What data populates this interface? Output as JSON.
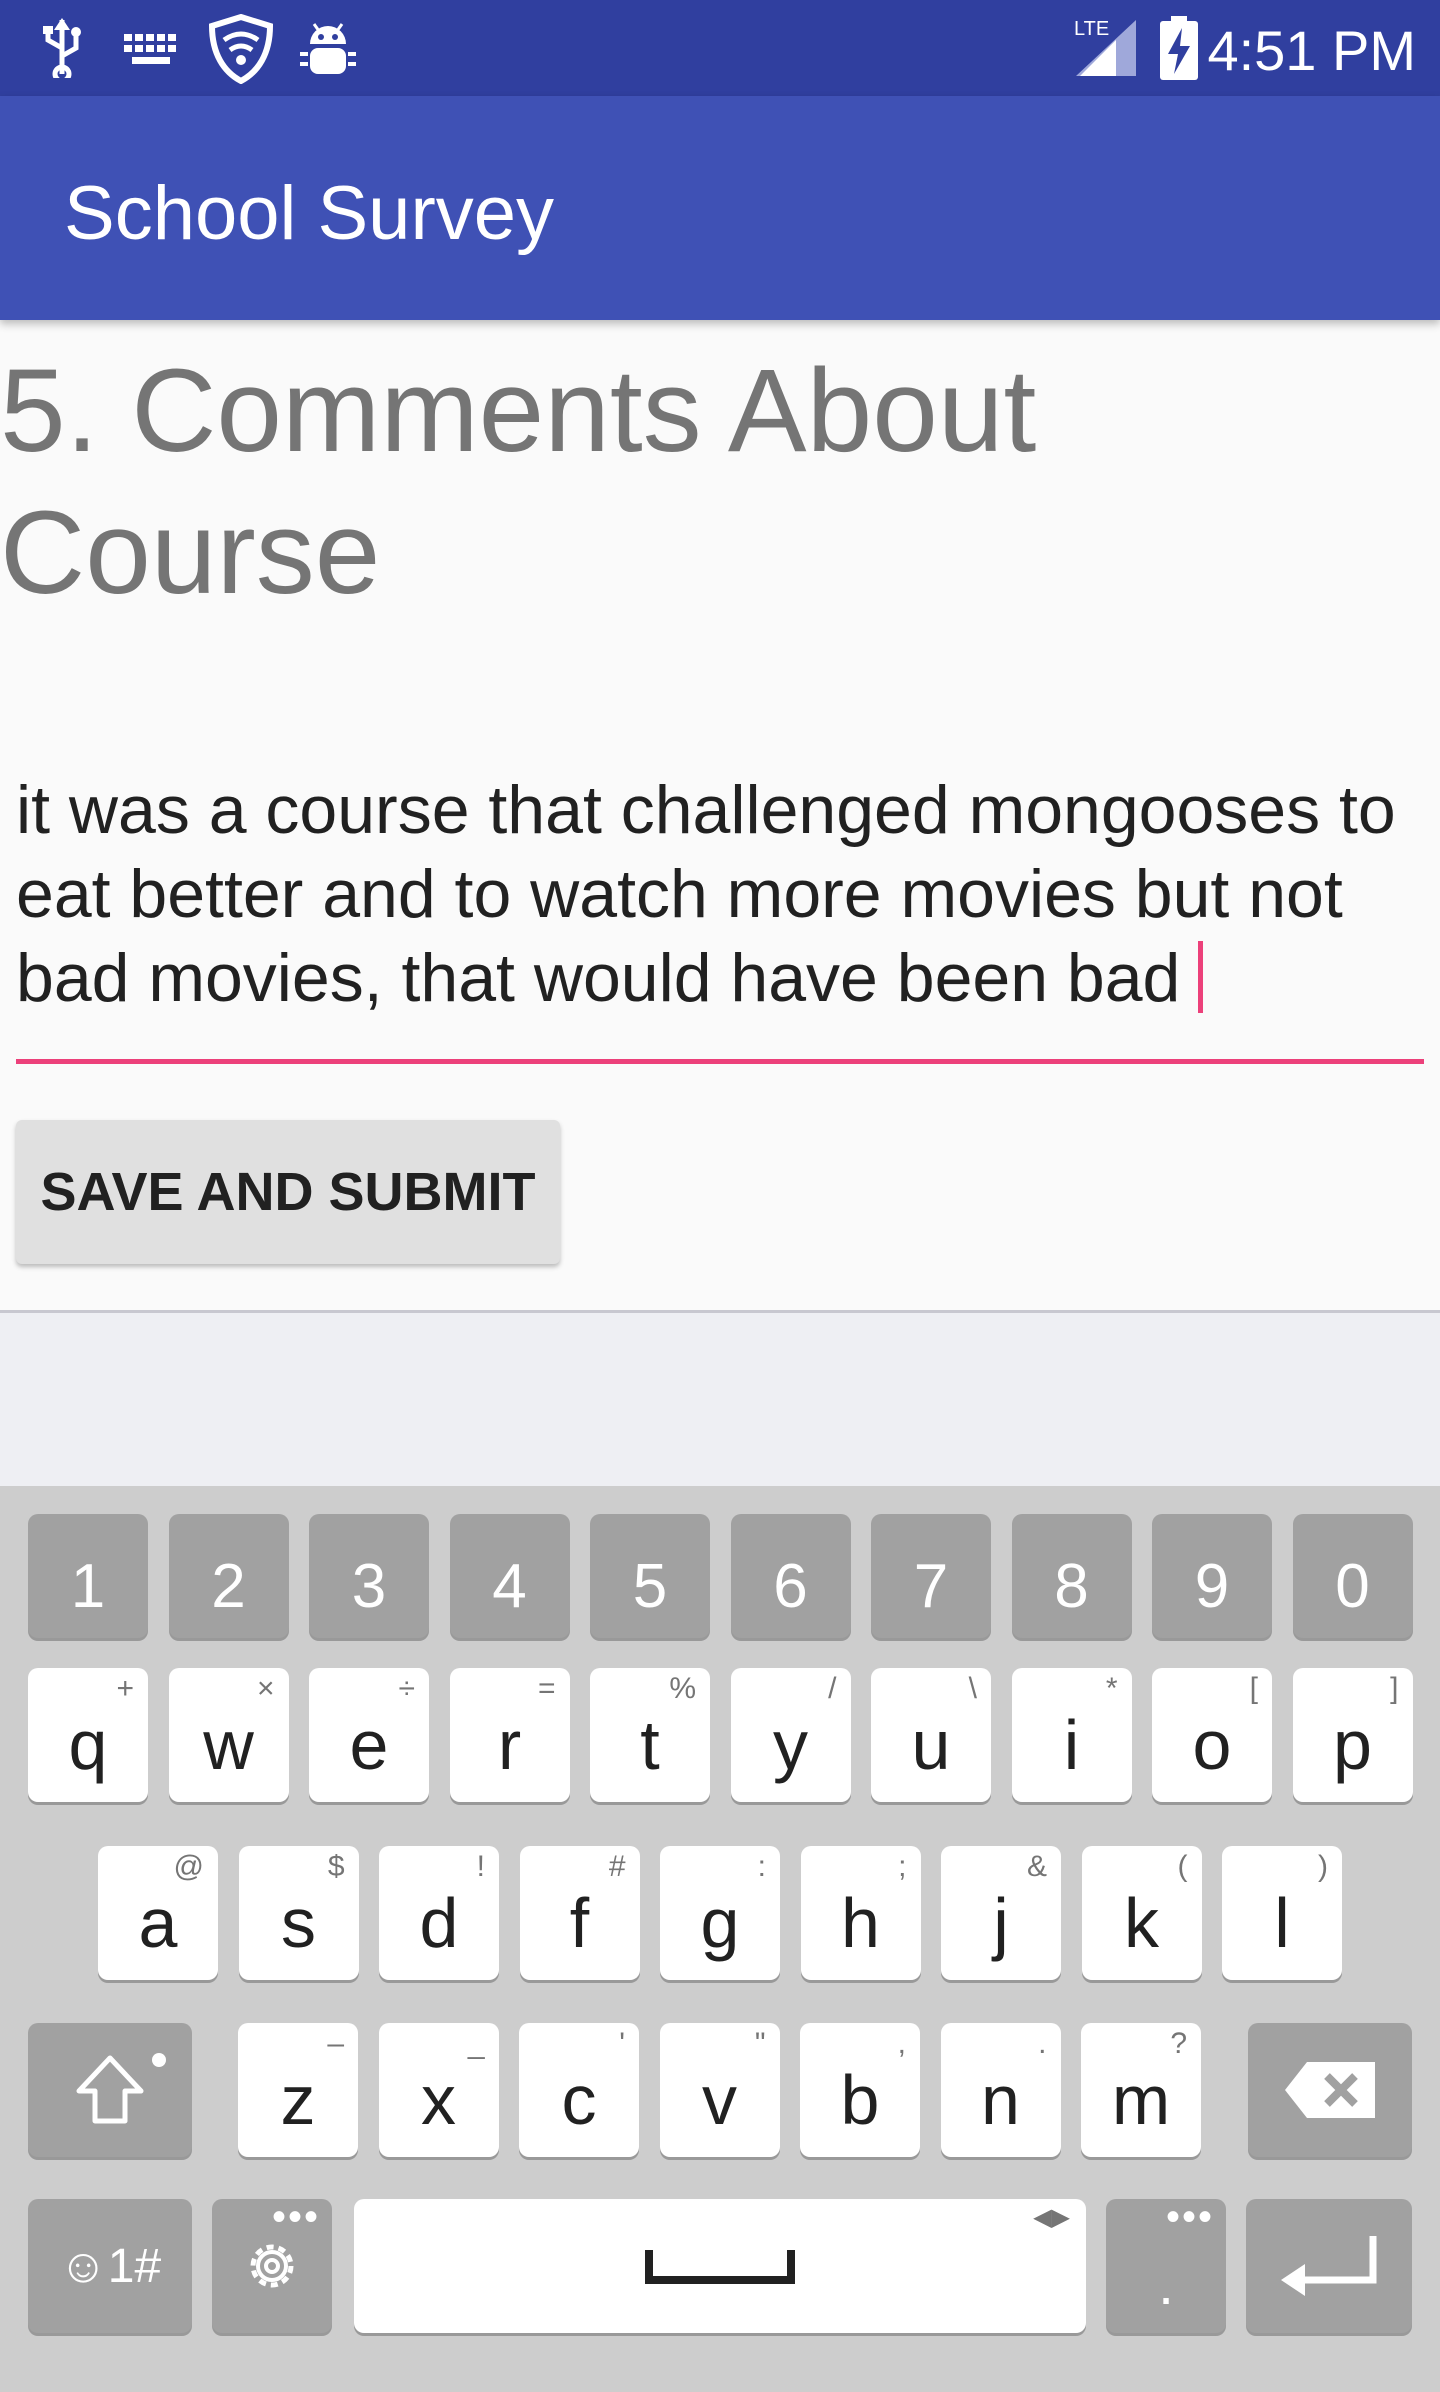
{
  "status_bar": {
    "time": "4:51 PM",
    "network": "LTE",
    "icons": [
      "usb-icon",
      "keyboard-icon",
      "shield-wifi-icon",
      "android-debug-icon",
      "signal-icon",
      "battery-charging-icon"
    ]
  },
  "app_bar": {
    "title": "School Survey"
  },
  "question": {
    "title": "5. Comments About Course"
  },
  "answer": {
    "text": "it was a course that challenged mongooses to eat better and to watch more movies but not bad movies, that would have been bad"
  },
  "submit": {
    "label": "SAVE AND SUBMIT"
  },
  "colors": {
    "status_bar": "#303f9f",
    "app_bar": "#3f51b5",
    "accent": "#ec407a"
  },
  "keyboard": {
    "number_row": [
      "1",
      "2",
      "3",
      "4",
      "5",
      "6",
      "7",
      "8",
      "9",
      "0"
    ],
    "row1": [
      {
        "key": "q",
        "hint": "+"
      },
      {
        "key": "w",
        "hint": "×"
      },
      {
        "key": "e",
        "hint": "÷"
      },
      {
        "key": "r",
        "hint": "="
      },
      {
        "key": "t",
        "hint": "%"
      },
      {
        "key": "y",
        "hint": "/"
      },
      {
        "key": "u",
        "hint": "\\"
      },
      {
        "key": "i",
        "hint": "*"
      },
      {
        "key": "o",
        "hint": "["
      },
      {
        "key": "p",
        "hint": "]"
      }
    ],
    "row2": [
      {
        "key": "a",
        "hint": "@"
      },
      {
        "key": "s",
        "hint": "$"
      },
      {
        "key": "d",
        "hint": "!"
      },
      {
        "key": "f",
        "hint": "#"
      },
      {
        "key": "g",
        "hint": ":"
      },
      {
        "key": "h",
        "hint": ";"
      },
      {
        "key": "j",
        "hint": "&"
      },
      {
        "key": "k",
        "hint": "("
      },
      {
        "key": "l",
        "hint": ")"
      }
    ],
    "row3": [
      {
        "key": "z",
        "hint": "–"
      },
      {
        "key": "x",
        "hint": "_"
      },
      {
        "key": "c",
        "hint": "'"
      },
      {
        "key": "v",
        "hint": "\""
      },
      {
        "key": "b",
        "hint": ","
      },
      {
        "key": "n",
        "hint": "."
      },
      {
        "key": "m",
        "hint": "?"
      }
    ],
    "symbols_label": "☺1#",
    "period": "."
  }
}
